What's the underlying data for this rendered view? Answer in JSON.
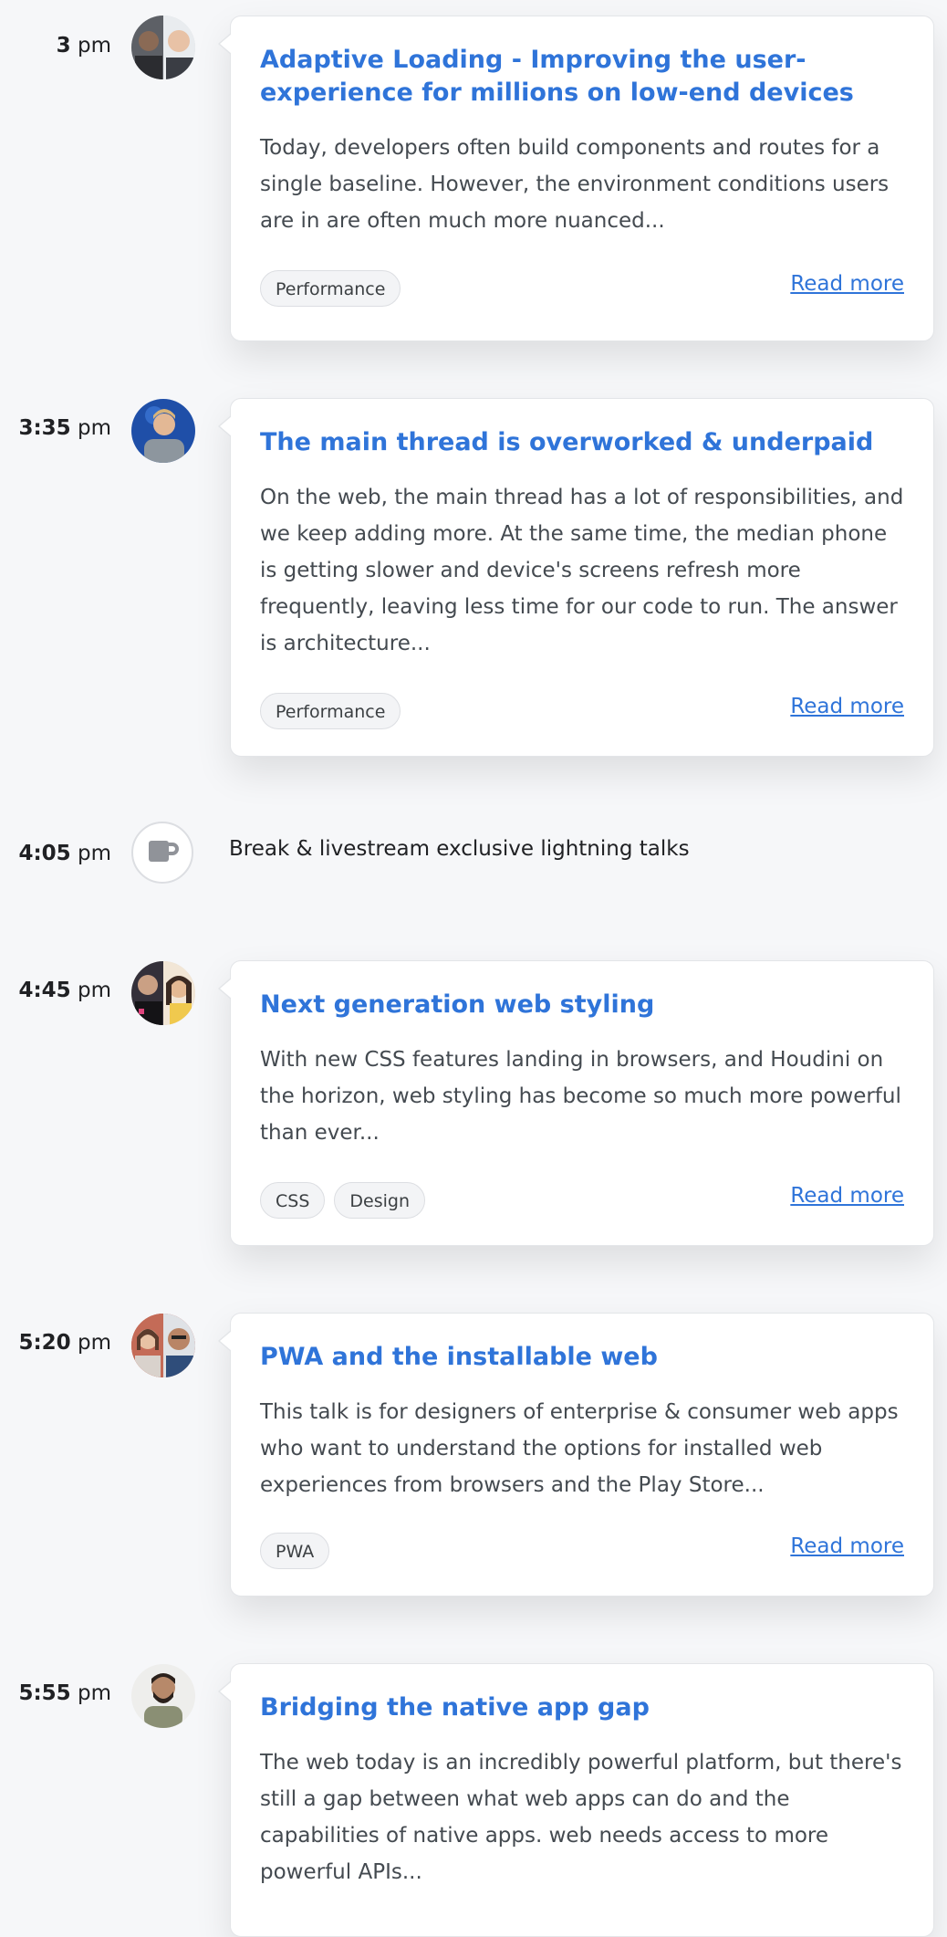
{
  "sessions": [
    {
      "time": "3",
      "ampm": "pm",
      "title": "Adaptive Loading - Improving the user-experience for millions on low-end devices",
      "description": "Today, developers often build components and routes for a single baseline. However, the environment conditions users are in are often much more nuanced...",
      "tags": [
        "Performance"
      ],
      "read_more": "Read more"
    },
    {
      "time": "3:35",
      "ampm": "pm",
      "title": "The main thread is overworked & underpaid",
      "description": "On the web, the main thread has a lot of responsibilities, and we keep adding more. At the same time, the median phone is getting slower and device's screens refresh more frequently, leaving less time for our code to run. The answer is architecture...",
      "tags": [
        "Performance"
      ],
      "read_more": "Read more"
    },
    {
      "time": "4:45",
      "ampm": "pm",
      "title": "Next generation web styling",
      "description": "With new CSS features landing in browsers, and Houdini on the horizon, web styling has become so much more powerful than ever...",
      "tags": [
        "CSS",
        "Design"
      ],
      "read_more": "Read more"
    },
    {
      "time": "5:20",
      "ampm": "pm",
      "title": "PWA and the installable web",
      "description": "This talk is for designers of enterprise & consumer web apps who want to understand the options for installed web experiences from browsers and the Play Store...",
      "tags": [
        "PWA"
      ],
      "read_more": "Read more"
    },
    {
      "time": "5:55",
      "ampm": "pm",
      "title": "Bridging the native app gap",
      "description": "The web today is an incredibly powerful platform, but there's still a gap between what web apps can do and the capabilities of native apps. web needs access to more powerful APIs...",
      "tags": [],
      "read_more": ""
    }
  ],
  "break_item": {
    "time": "4:05",
    "ampm": "pm",
    "label": "Break & livestream exclusive lightning talks",
    "icon": "coffee-cup-icon"
  },
  "colors": {
    "accent": "#2f74d9",
    "background": "#f6f7f9",
    "card": "#ffffff"
  }
}
